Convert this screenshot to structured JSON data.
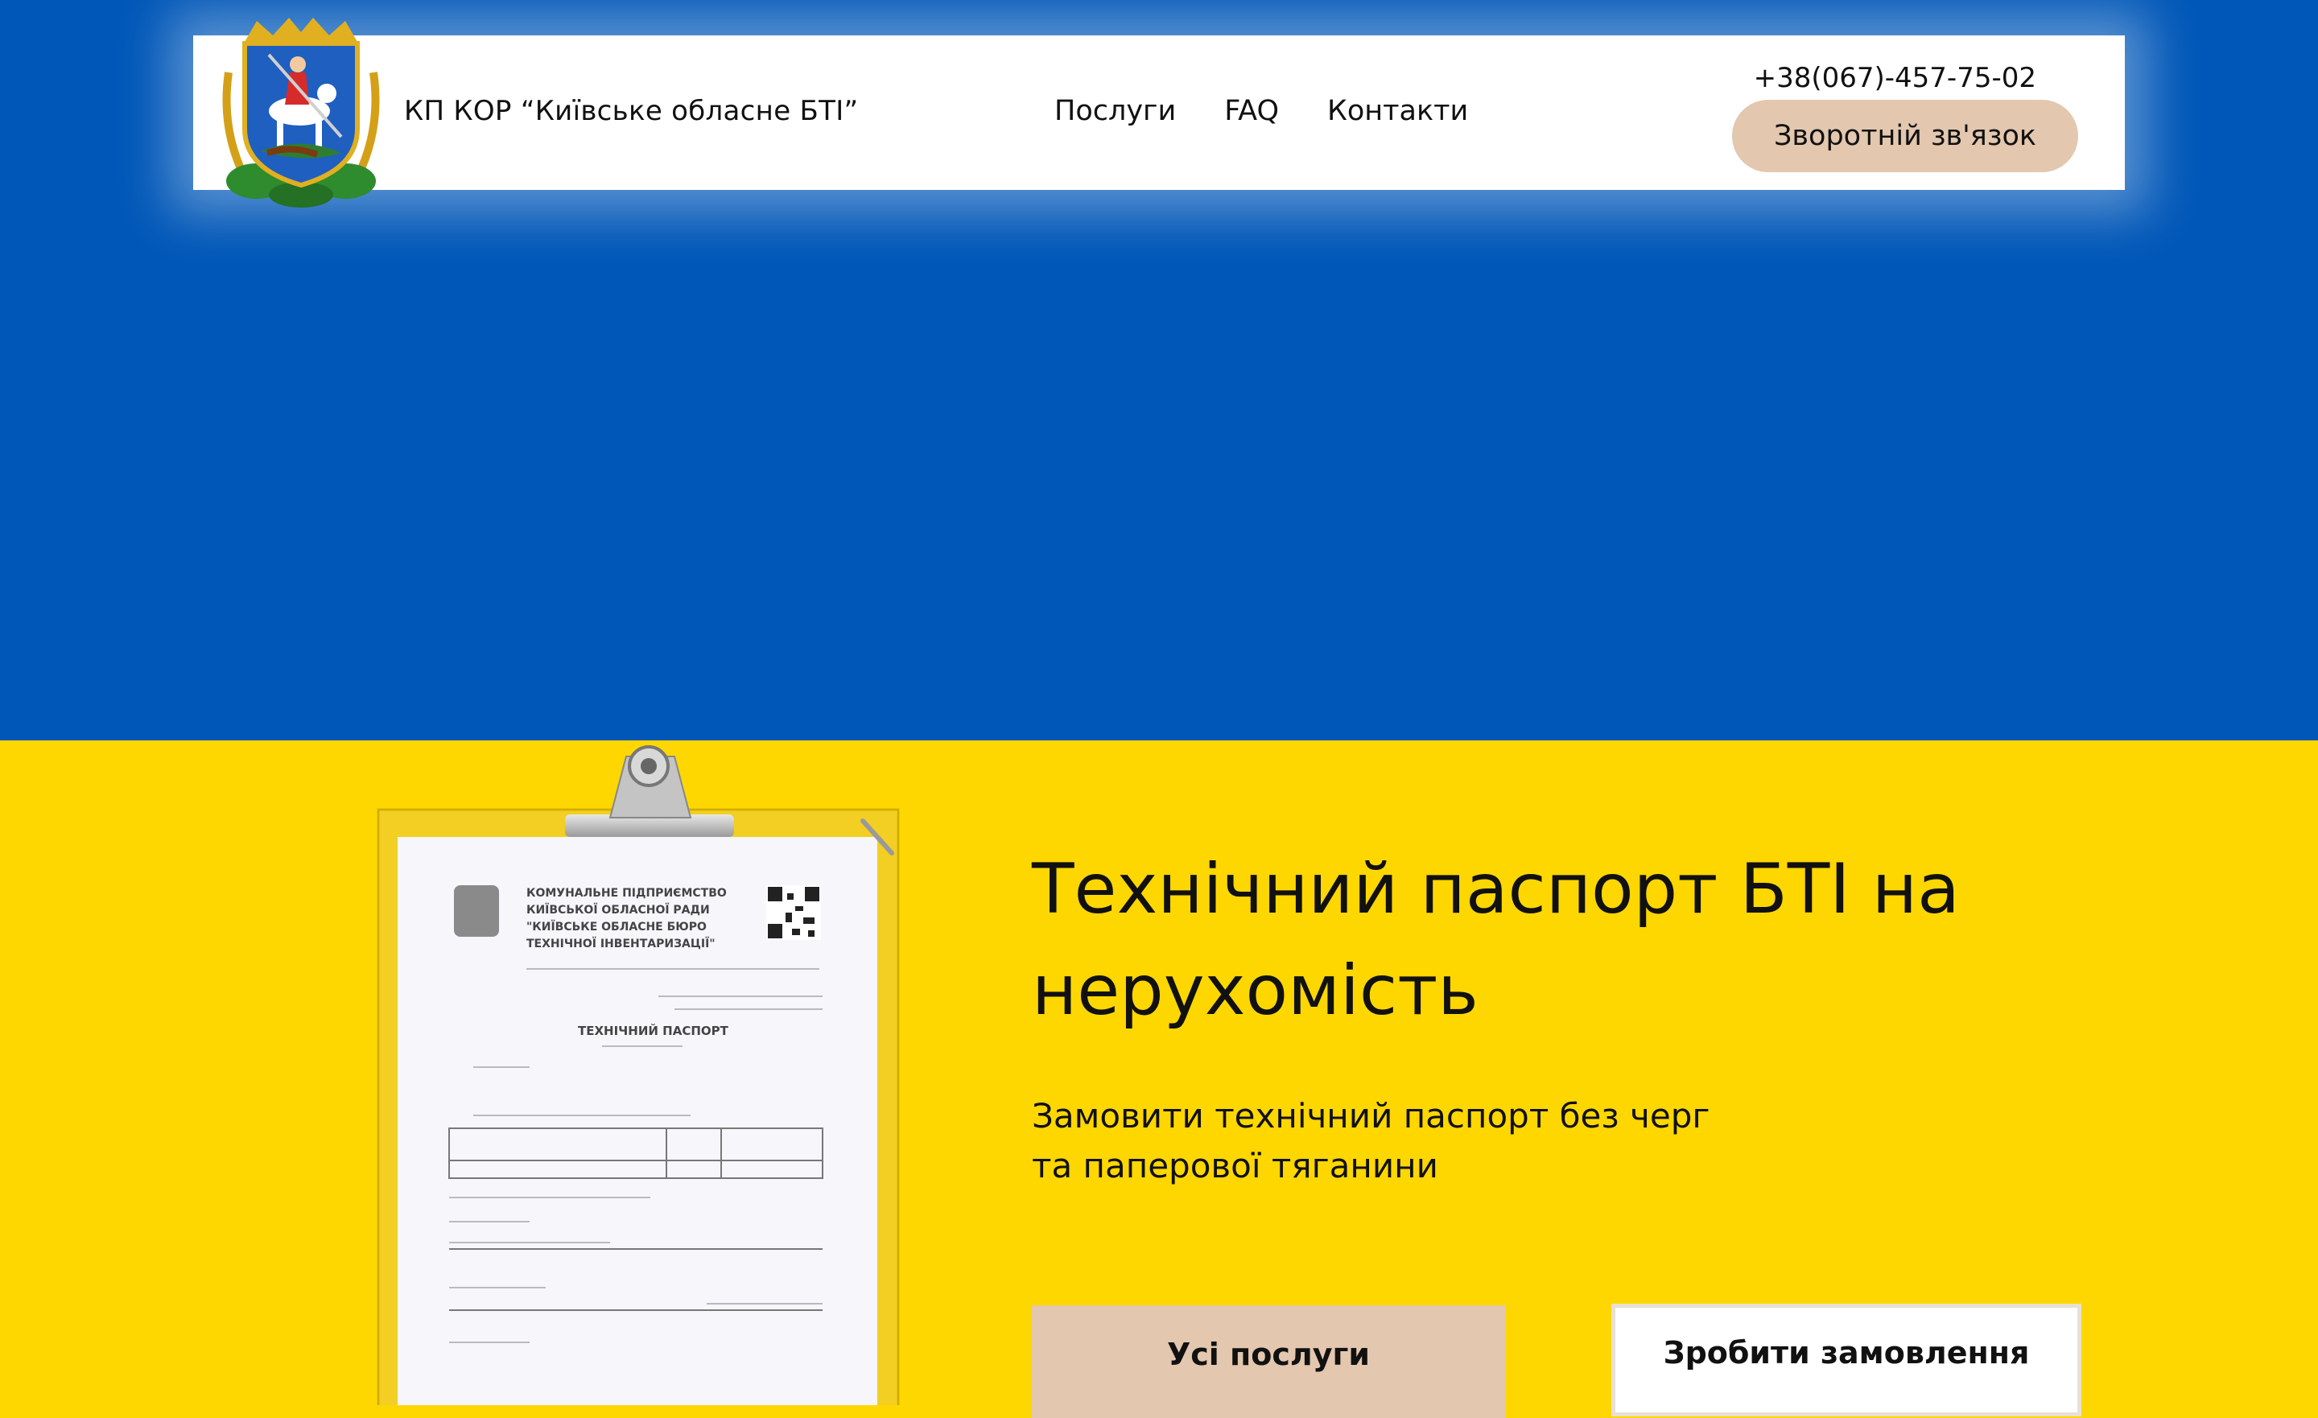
{
  "header": {
    "org_name": "КП КОР “Київське обласне БТІ”",
    "nav": [
      "Послуги",
      "FAQ",
      "Контакти"
    ],
    "phone": "+38(067)-457-75-02",
    "callback_label": "Зворотній зв'язок"
  },
  "hero": {
    "title": "Технічний паспорт БТІ на нерухомість",
    "subtitle_line1": "Замовити технічний паспорт без черг",
    "subtitle_line2": "та паперової тяганини",
    "primary_button": "Усі послуги",
    "secondary_button": "Зробити замовлення"
  },
  "document": {
    "org_lines": [
      "КОМУНАЛЬНЕ ПІДПРИЄМСТВО",
      "КИЇВСЬКОЇ ОБЛАСНОЇ РАДИ",
      "\"КИЇВСЬКЕ ОБЛАСНЕ БЮРО",
      "ТЕХНІЧНОЇ ІНВЕНТАРИЗАЦІЇ\""
    ],
    "doc_title": "ТЕХНІЧНИЙ ПАСПОРТ"
  },
  "colors": {
    "blue": "#0057b8",
    "yellow": "#ffd700",
    "accent_beige": "#e3c7ae"
  },
  "icons": [
    "kyiv-oblast-coat-of-arms-icon",
    "qr-code-icon",
    "clipboard-clip-icon"
  ]
}
